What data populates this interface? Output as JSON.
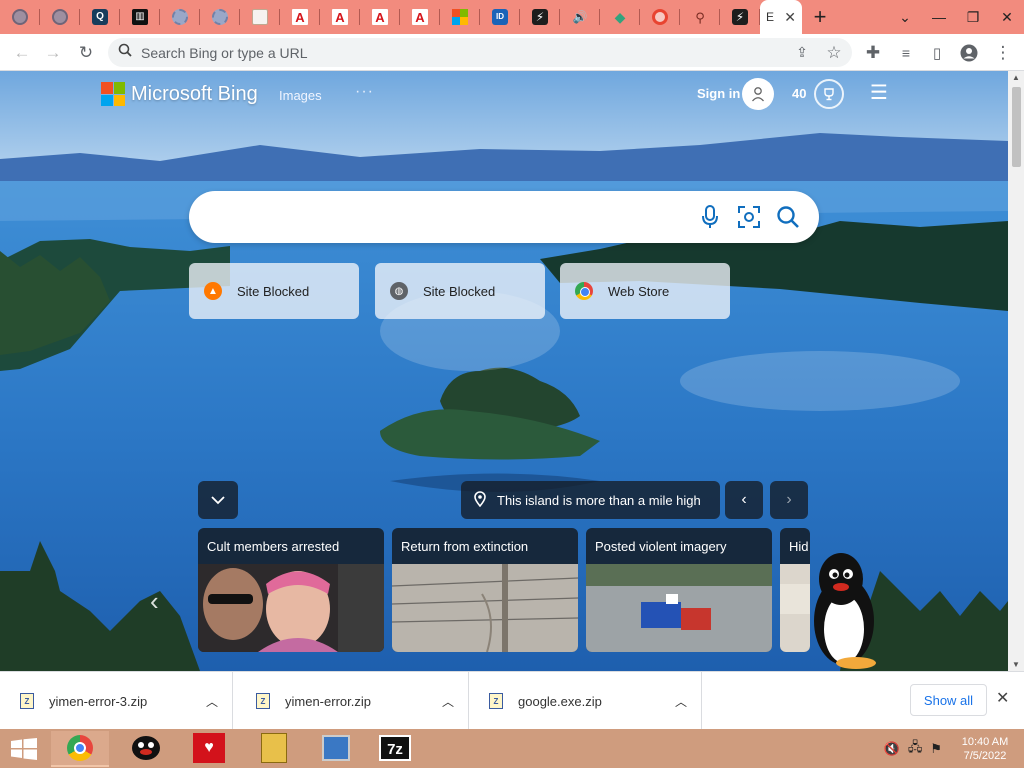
{
  "browser": {
    "tabs": [
      {
        "icon": "globe-icon",
        "glyph": ""
      },
      {
        "icon": "globe-icon",
        "glyph": ""
      },
      {
        "icon": "qbox-icon",
        "glyph": "Q"
      },
      {
        "icon": "bank-icon",
        "glyph": "▥"
      },
      {
        "icon": "gear-icon",
        "glyph": ""
      },
      {
        "icon": "gear-icon",
        "glyph": ""
      },
      {
        "icon": "document-icon",
        "glyph": ""
      },
      {
        "icon": "adobe-icon",
        "glyph": "A"
      },
      {
        "icon": "adobe-icon",
        "glyph": "A"
      },
      {
        "icon": "adobe-icon",
        "glyph": "A"
      },
      {
        "icon": "adobe-icon",
        "glyph": "A"
      },
      {
        "icon": "microsoft-icon",
        "glyph": ""
      },
      {
        "icon": "blue-app-icon",
        "glyph": "ID"
      },
      {
        "icon": "bolt-icon",
        "glyph": "⚡"
      },
      {
        "icon": "speaker-icon",
        "glyph": "🔊"
      },
      {
        "icon": "gem-icon",
        "glyph": "◆"
      },
      {
        "icon": "record-icon",
        "glyph": ""
      },
      {
        "icon": "search-icon",
        "glyph": "⚲"
      },
      {
        "icon": "bolt-icon",
        "glyph": "⚡"
      }
    ],
    "active_tab": {
      "title": "E",
      "close": "✕"
    },
    "new_tab": "+",
    "address_placeholder": "Search Bing or type a URL"
  },
  "bing": {
    "brand": "Microsoft Bing",
    "nav_images": "Images",
    "nav_more": "···",
    "sign_in": "Sign in",
    "points": "40",
    "search_value": "",
    "tiles": [
      {
        "label": "Site Blocked",
        "icon": "avast-icon"
      },
      {
        "label": "Site Blocked",
        "icon": "globe-icon"
      },
      {
        "label": "Web Store",
        "icon": "chrome-icon"
      }
    ],
    "caption": "This island is more than a mile high",
    "news": [
      {
        "title": "Cult members arrested"
      },
      {
        "title": "Return from extinction"
      },
      {
        "title": "Posted violent imagery"
      },
      {
        "title": "Hid"
      }
    ],
    "colors": {
      "accent": "#106ebe",
      "sky": "#7fb2e2",
      "lake": "#2f7fcf"
    }
  },
  "downloads": {
    "items": [
      {
        "name": "yimen-error-3.zip"
      },
      {
        "name": "yimen-error.zip"
      },
      {
        "name": "google.exe.zip"
      }
    ],
    "show_all": "Show all"
  },
  "taskbar": {
    "time": "10:40 AM",
    "date": "7/5/2022",
    "apps": [
      "chrome-icon",
      "pingu-icon",
      "walls-icon",
      "archive-icon",
      "network-icon",
      "7zip-icon"
    ],
    "sevenzip_label": "7z"
  }
}
